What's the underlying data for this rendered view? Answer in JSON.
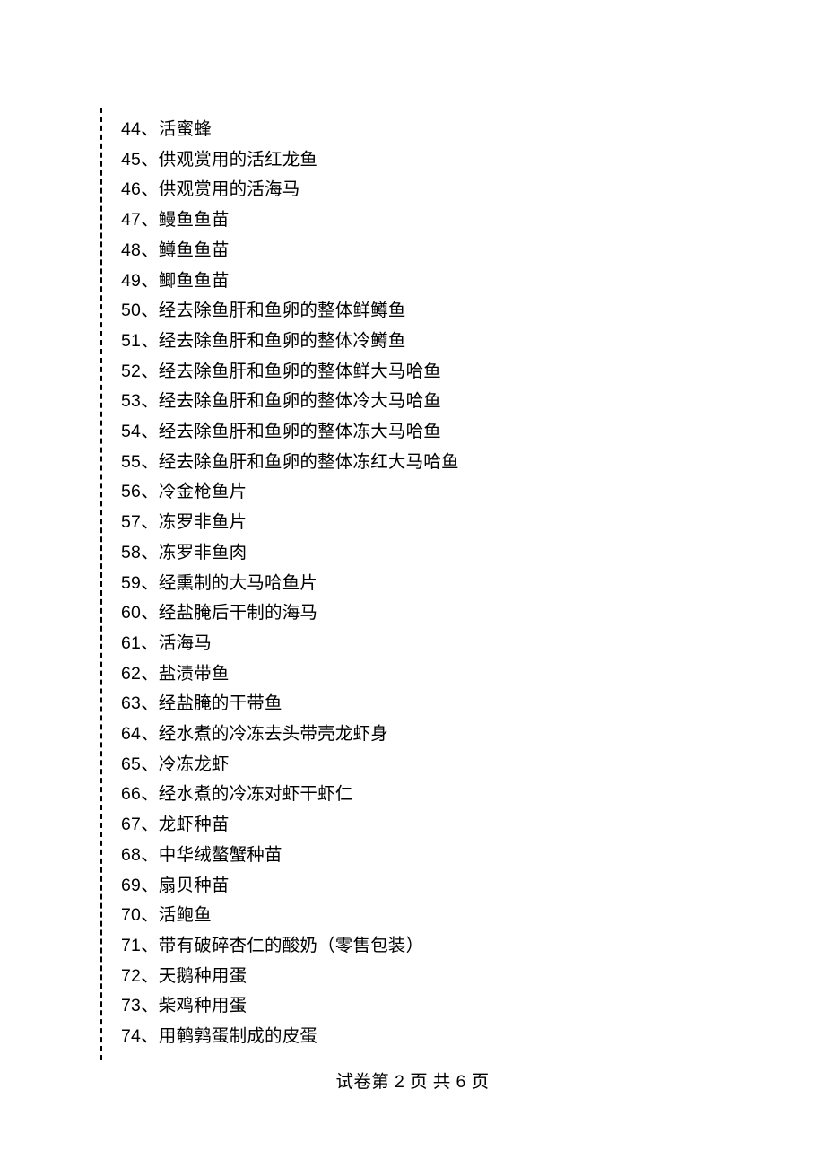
{
  "list": {
    "start": 44,
    "separator": "、",
    "items": [
      "活蜜蜂",
      "供观赏用的活红龙鱼",
      "供观赏用的活海马",
      "鳗鱼鱼苗",
      "鳟鱼鱼苗",
      "鲫鱼鱼苗",
      "经去除鱼肝和鱼卵的整体鲜鳟鱼",
      "经去除鱼肝和鱼卵的整体冷鳟鱼",
      "经去除鱼肝和鱼卵的整体鲜大马哈鱼",
      "经去除鱼肝和鱼卵的整体冷大马哈鱼",
      "经去除鱼肝和鱼卵的整体冻大马哈鱼",
      "经去除鱼肝和鱼卵的整体冻红大马哈鱼",
      "冷金枪鱼片",
      "冻罗非鱼片",
      "冻罗非鱼肉",
      "经熏制的大马哈鱼片",
      "经盐腌后干制的海马",
      "活海马",
      "盐渍带鱼",
      "经盐腌的干带鱼",
      "经水煮的冷冻去头带壳龙虾身",
      "冷冻龙虾",
      "经水煮的冷冻对虾干虾仁",
      "龙虾种苗",
      "中华绒螯蟹种苗",
      "扇贝种苗",
      "活鲍鱼",
      "带有破碎杏仁的酸奶（零售包装）",
      "天鹅种用蛋",
      "柴鸡种用蛋",
      "用鹌鹑蛋制成的皮蛋"
    ]
  },
  "footer": {
    "prefix": "试卷第 ",
    "page": "2",
    "middle": " 页 共 ",
    "total": "6",
    "suffix": " 页"
  }
}
